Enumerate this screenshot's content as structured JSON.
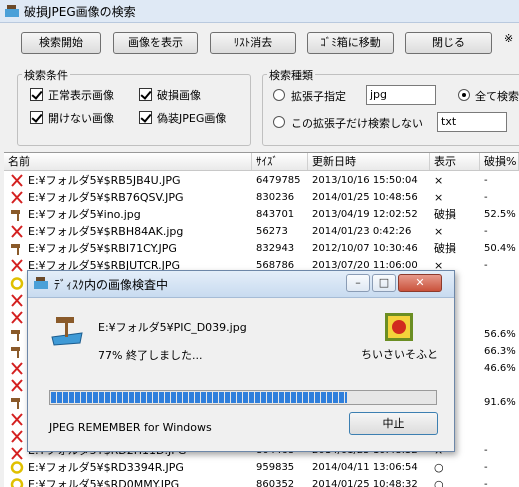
{
  "window": {
    "title": "破損JPEG画像の検索"
  },
  "toolbar": {
    "search_start": "検索開始",
    "show_image": "画像を表示",
    "clear_list": "ﾘｽﾄ消去",
    "move_to_trash": "ｺﾞﾐ箱に移動",
    "close": "閉じる",
    "note": "※"
  },
  "conditions": {
    "title": "検索条件",
    "normal_images": "正常表示画像",
    "damaged_images": "破損画像",
    "unopenable_images": "開けない画像",
    "fake_jpeg": "偽装JPEG画像"
  },
  "search_type": {
    "title": "検索種類",
    "ext_option": "拡張子指定",
    "ext_value": "jpg",
    "all_option": "全て検索",
    "exclude_option": "この拡張子だけ検索しない",
    "exclude_value": "txt"
  },
  "columns": [
    "名前",
    "ｻｲｽﾞ",
    "更新日時",
    "表示",
    "破損%"
  ],
  "rows": [
    {
      "name": "E:¥フォルダ5¥$RB5JB4U.JPG",
      "size": "6479785",
      "date": "2013/10/16 15:50:04",
      "display": "×",
      "damage": "-"
    },
    {
      "name": "E:¥フォルダ5¥$RB76QSV.JPG",
      "size": "830236",
      "date": "2014/01/25 10:48:56",
      "display": "×",
      "damage": "-"
    },
    {
      "name": "E:¥フォルダ5¥ino.jpg",
      "size": "843701",
      "date": "2013/04/19 12:02:52",
      "display": "破損",
      "damage": "52.5%"
    },
    {
      "name": "E:¥フォルダ5¥$RBH84AK.jpg",
      "size": "56273",
      "date": "2014/01/23 0:42:26",
      "display": "×",
      "damage": "-"
    },
    {
      "name": "E:¥フォルダ5¥$RBI71CY.JPG",
      "size": "832943",
      "date": "2012/10/07 10:30:46",
      "display": "破損",
      "damage": "50.4%"
    },
    {
      "name": "E:¥フォルダ5¥$RBJUTCR.JPG",
      "size": "568786",
      "date": "2013/07/20 11:06:00",
      "display": "×",
      "damage": "-"
    }
  ],
  "partial_row": {
    "name": "E:¥フォルダ5¥$RD2H11D.JPG",
    "size": "804468",
    "date": "2014/01/25 10:48:32",
    "display": "×",
    "damage": "-"
  },
  "bottom_rows": [
    {
      "name": "E:¥フォルダ5¥$RD3394R.JPG",
      "size": "959835",
      "date": "2014/04/11 13:06:54",
      "display": "○",
      "damage": "-"
    },
    {
      "name": "E:¥フォルダ5¥$RD0MMY.JPG",
      "size": "860352",
      "date": "2014/01/25 10:48:32",
      "display": "○",
      "damage": "-"
    }
  ],
  "side_values": [
    "56.6%",
    "66.3%",
    "46.6%",
    "91.6%"
  ],
  "dialog": {
    "title": "ﾃﾞｨｽｸ内の画像検査中",
    "file": "E:¥フォルダ5¥PIC_D039.jpg",
    "status": "77%  終了しました...",
    "progress": 0.77,
    "brand": "ちいさいそふと",
    "footer": "JPEG REMEMBER for Windows",
    "cancel": "中止"
  }
}
